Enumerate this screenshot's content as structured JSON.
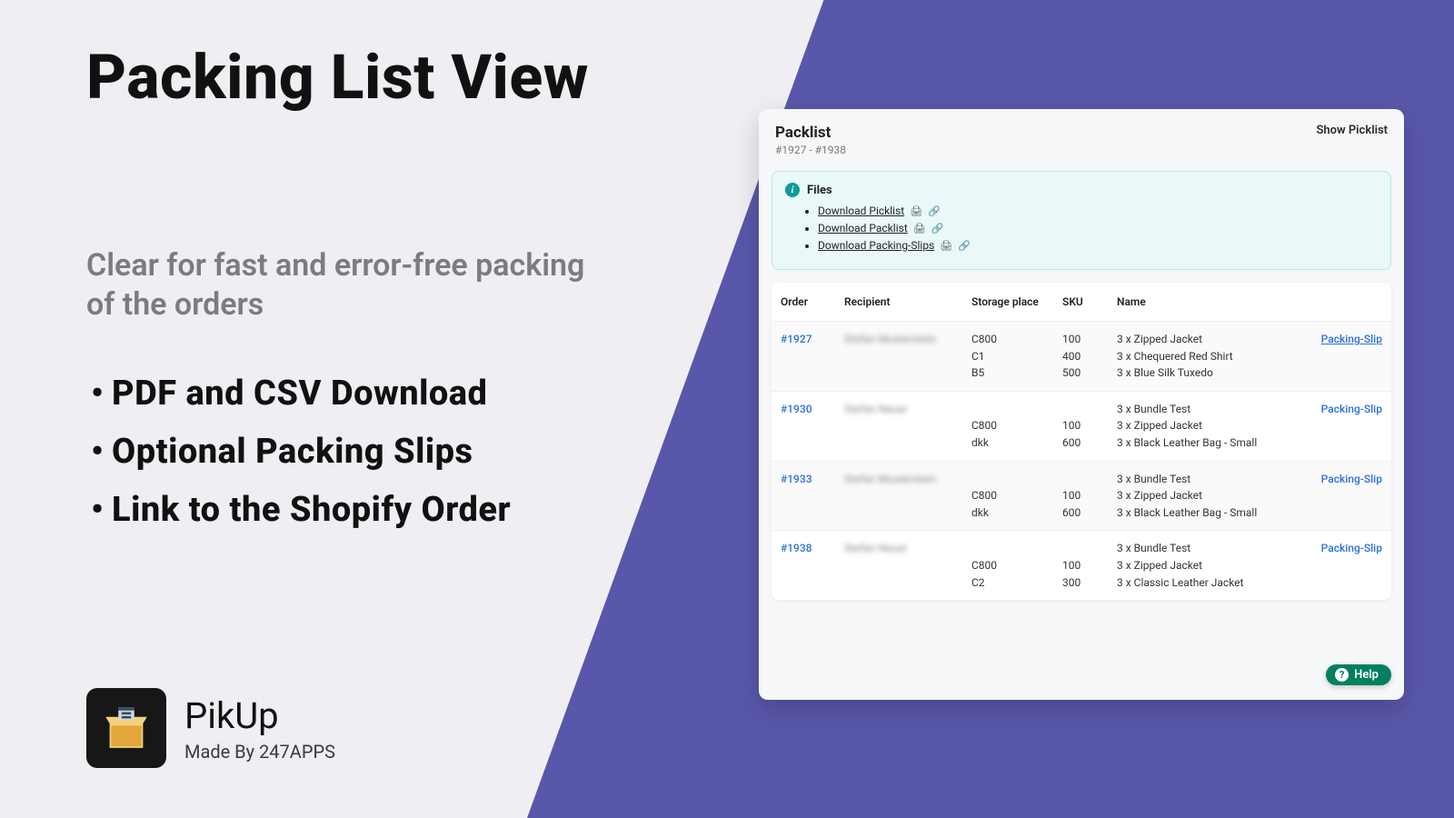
{
  "marketing": {
    "title": "Packing List View",
    "subhead": "Clear for fast and error-free packing of the orders",
    "bullets": [
      "PDF and CSV Download",
      "Optional Packing Slips",
      "Link to the Shopify Order"
    ]
  },
  "brand": {
    "name": "PikUp",
    "made_by": "Made By 247APPS"
  },
  "panel": {
    "title": "Packlist",
    "range": "#1927 - #1938",
    "show_picklist": "Show Picklist",
    "files": {
      "heading": "Files",
      "items": [
        "Download Picklist",
        "Download Packlist",
        "Download Packing-Slips"
      ]
    },
    "table": {
      "headers": {
        "order": "Order",
        "recipient": "Recipient",
        "storage": "Storage place",
        "sku": "SKU",
        "name": "Name",
        "slip": ""
      },
      "rows": [
        {
          "order": "#1927",
          "recipient": "Stefan Musterstein",
          "storage": [
            "C800",
            "C1",
            "B5"
          ],
          "sku": [
            "100",
            "400",
            "500"
          ],
          "name": [
            "3 x Zipped Jacket",
            "3 x Chequered Red Shirt",
            "3 x Blue Silk Tuxedo"
          ],
          "slip": "Packing-Slip",
          "slip_underline": true
        },
        {
          "order": "#1930",
          "recipient": "Stefan Neuer",
          "storage": [
            "",
            "C800",
            "dkk"
          ],
          "sku": [
            "",
            "100",
            "600"
          ],
          "name": [
            "3 x Bundle Test",
            "3 x Zipped Jacket",
            "3 x Black Leather Bag - Small"
          ],
          "slip": "Packing-Slip",
          "slip_underline": false
        },
        {
          "order": "#1933",
          "recipient": "Stefan Musterstein",
          "storage": [
            "",
            "C800",
            "dkk"
          ],
          "sku": [
            "",
            "100",
            "600"
          ],
          "name": [
            "3 x Bundle Test",
            "3 x Zipped Jacket",
            "3 x Black Leather Bag - Small"
          ],
          "slip": "Packing-Slip",
          "slip_underline": false
        },
        {
          "order": "#1938",
          "recipient": "Stefan Neuer",
          "storage": [
            "",
            "C800",
            "C2"
          ],
          "sku": [
            "",
            "100",
            "300"
          ],
          "name": [
            "3 x Bundle Test",
            "3 x Zipped Jacket",
            "3 x Classic Leather Jacket"
          ],
          "slip": "Packing-Slip",
          "slip_underline": false
        }
      ]
    },
    "help": "Help"
  }
}
